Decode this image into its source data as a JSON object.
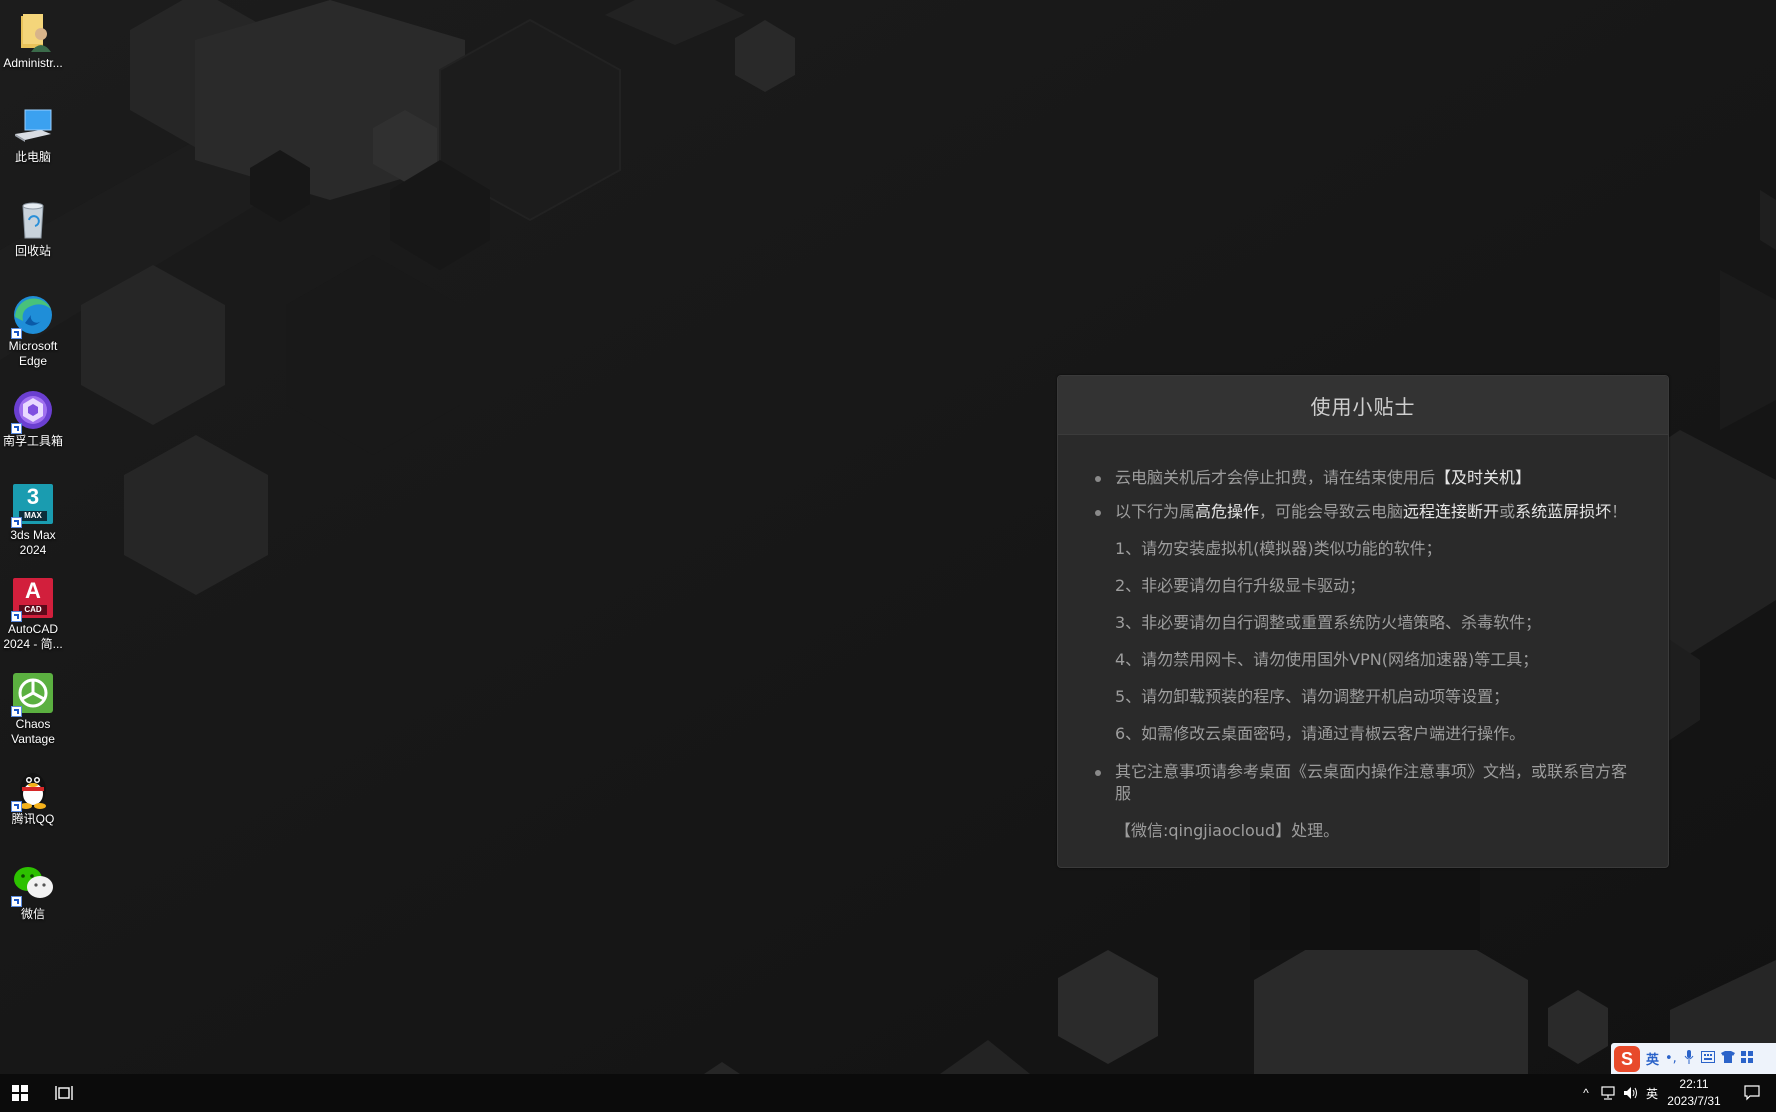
{
  "desktop": {
    "icons": [
      {
        "label": "Administr...",
        "icon": "user-folder-icon"
      },
      {
        "label": "此电脑",
        "icon": "computer-icon"
      },
      {
        "label": "回收站",
        "icon": "recycle-bin-icon"
      },
      {
        "label": "Microsoft Edge",
        "icon": "edge-icon"
      },
      {
        "label": "南孚工具箱",
        "icon": "toolbox-icon"
      },
      {
        "label": "3ds Max 2024",
        "icon": "3dsmax-icon",
        "glyph": "3",
        "sub": "MAX"
      },
      {
        "label": "AutoCAD 2024 - 简...",
        "icon": "autocad-icon",
        "glyph": "A",
        "sub": "CAD"
      },
      {
        "label": "Chaos Vantage",
        "icon": "chaos-vantage-icon"
      },
      {
        "label": "腾讯QQ",
        "icon": "qq-icon"
      },
      {
        "label": "微信",
        "icon": "wechat-icon"
      }
    ]
  },
  "tips": {
    "title": "使用小贴士",
    "b1_pre": "云电脑关机后才会停止扣费，请在结束使用后",
    "b1_hl": "【及时关机】",
    "b2_pre": "以下行为属",
    "b2_hl1": "高危操作",
    "b2_mid": "，可能会导致云电脑",
    "b2_hl2": "远程连接断开",
    "b2_or": "或",
    "b2_hl3": "系统蓝屏损坏",
    "b2_end": "！",
    "items": [
      "1、请勿安装虚拟机(模拟器)类似功能的软件；",
      "2、非必要请勿自行升级显卡驱动；",
      "3、非必要请勿自行调整或重置系统防火墙策略、杀毒软件；",
      "4、请勿禁用网卡、请勿使用国外VPN(网络加速器)等工具；",
      "5、请勿卸载预装的程序、请勿调整开机启动项等设置；",
      "6、如需修改云桌面密码，请通过青椒云客户端进行操作。"
    ],
    "b3_text": "其它注意事项请参考桌面《云桌面内操作注意事项》文档，或联系官方客服",
    "b3_hl": "【微信:qingjiaocloud】",
    "b3_end": "处理。"
  },
  "ime": {
    "logo": "S",
    "lang": "英",
    "punct": "•,",
    "icons": [
      "mic-icon",
      "keyboard-icon",
      "skin-icon",
      "grid-icon"
    ]
  },
  "taskbar": {
    "start_icon": "windows-icon",
    "taskview_icon": "task-view-icon",
    "tray": {
      "chevron": "^",
      "lang": "英",
      "time": "22:11",
      "date": "2023/7/31"
    }
  },
  "colors": {
    "background": "#151515",
    "panel": "#2a2a2a",
    "panel_header": "#333333",
    "highlight_text": "#e6e6e6",
    "body_text": "#9d9d9d",
    "taskbar": "#0b0b0b"
  }
}
